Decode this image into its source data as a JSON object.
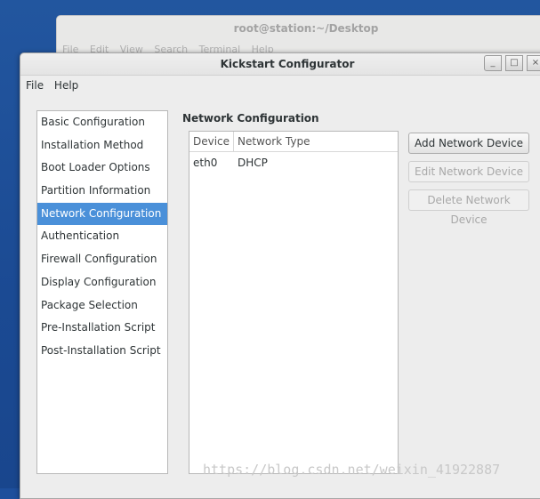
{
  "terminal": {
    "title": "root@station:~/Desktop",
    "menu": [
      "File",
      "Edit",
      "View",
      "Search",
      "Terminal",
      "Help"
    ]
  },
  "window": {
    "title": "Kickstart Configurator",
    "controls": {
      "minimize": "_",
      "maximize": "□",
      "close": "×"
    }
  },
  "menubar": {
    "file": "File",
    "help": "Help"
  },
  "sidebar": {
    "items": [
      {
        "label": "Basic Configuration"
      },
      {
        "label": "Installation Method"
      },
      {
        "label": "Boot Loader Options"
      },
      {
        "label": "Partition Information"
      },
      {
        "label": "Network Configuration",
        "selected": true
      },
      {
        "label": "Authentication"
      },
      {
        "label": "Firewall Configuration"
      },
      {
        "label": "Display Configuration"
      },
      {
        "label": "Package Selection"
      },
      {
        "label": "Pre-Installation Script"
      },
      {
        "label": "Post-Installation Script"
      }
    ]
  },
  "main": {
    "section_title": "Network Configuration",
    "table": {
      "columns": [
        "Device",
        "Network Type"
      ],
      "rows": [
        {
          "device": "eth0",
          "type": "DHCP"
        }
      ]
    },
    "buttons": {
      "add": "Add Network Device",
      "edit": "Edit Network Device",
      "delete": "Delete Network Device"
    }
  },
  "watermark": "https://blog.csdn.net/weixin_41922887",
  "colors": {
    "selection": "#4a90d9",
    "desktop": "#1e4f9c"
  }
}
